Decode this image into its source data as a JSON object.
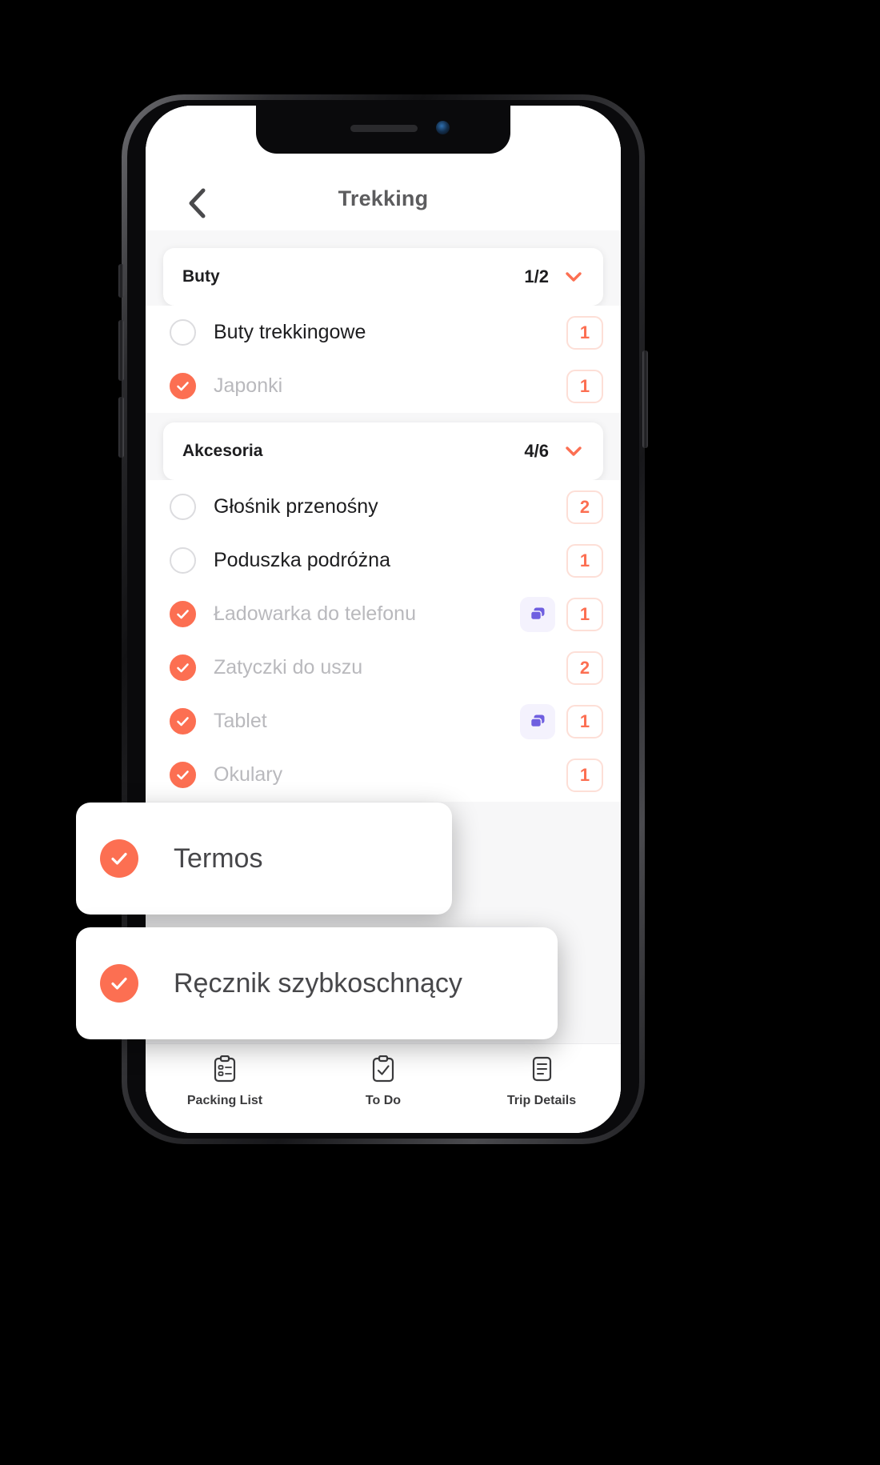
{
  "app": {
    "nav": {
      "title": "Trekking",
      "back_icon": "chevron-left-icon"
    },
    "groups": [
      {
        "title": "Buty",
        "count": "1/2",
        "chevron_icon": "chevron-down-icon",
        "items": [
          {
            "label": "Buty trekkingowe",
            "checked": false,
            "qty": "1",
            "note": false
          },
          {
            "label": "Japonki",
            "checked": true,
            "qty": "1",
            "note": false
          }
        ]
      },
      {
        "title": "Akcesoria",
        "count": "4/6",
        "chevron_icon": "chevron-down-icon",
        "items": [
          {
            "label": "Głośnik przenośny",
            "checked": false,
            "qty": "2",
            "note": false
          },
          {
            "label": "Poduszka podróżna",
            "checked": false,
            "qty": "1",
            "note": false
          },
          {
            "label": "Ładowarka do telefonu",
            "checked": true,
            "qty": "1",
            "note": true
          },
          {
            "label": "Zatyczki do uszu",
            "checked": true,
            "qty": "2",
            "note": false
          },
          {
            "label": "Tablet",
            "checked": true,
            "qty": "1",
            "note": true
          },
          {
            "label": "Okulary",
            "checked": true,
            "qty": "1",
            "note": false
          }
        ]
      }
    ],
    "tabs": [
      {
        "label": "Packing List",
        "icon": "clipboard-list-icon"
      },
      {
        "label": "To Do",
        "icon": "clipboard-check-icon"
      },
      {
        "label": "Trip Details",
        "icon": "document-lines-icon"
      }
    ]
  },
  "floating_cards": [
    {
      "label": "Termos",
      "checked": true,
      "check_icon": "check-icon"
    },
    {
      "label": "Ręcznik szybkoschnący",
      "checked": true,
      "check_icon": "check-icon"
    }
  ],
  "colors": {
    "accent": "#fc6f52",
    "badge_border": "#fddfd7",
    "note_bg": "#f4f2fd",
    "note_fg": "#6f5fe0",
    "text_primary": "#1d1d1f",
    "text_muted": "#b9b9bd",
    "nav_title": "#5c5c5e",
    "list_bg": "#f7f7f8",
    "background": "#000000"
  }
}
